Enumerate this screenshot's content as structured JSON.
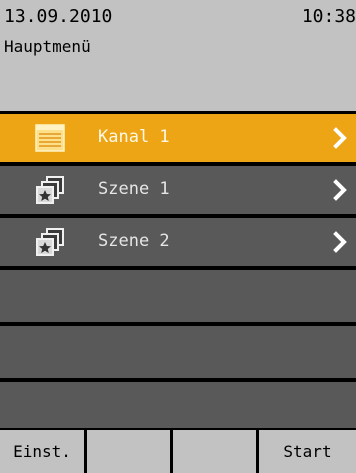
{
  "header": {
    "date": "13.09.2010",
    "time": "10:38",
    "title": "Hauptmenü"
  },
  "menu": {
    "items": [
      {
        "label": "Kanal 1",
        "icon": "channel-list-icon",
        "selected": true
      },
      {
        "label": "Szene 1",
        "icon": "scene-icon",
        "selected": false
      },
      {
        "label": "Szene 2",
        "icon": "scene-icon",
        "selected": false
      }
    ]
  },
  "softkeys": {
    "labels": [
      "Einst.",
      "",
      "",
      "Start"
    ]
  },
  "colors": {
    "selected": "#eea515",
    "row": "#595959",
    "header": "#c2c2c2",
    "background": "#000000"
  }
}
